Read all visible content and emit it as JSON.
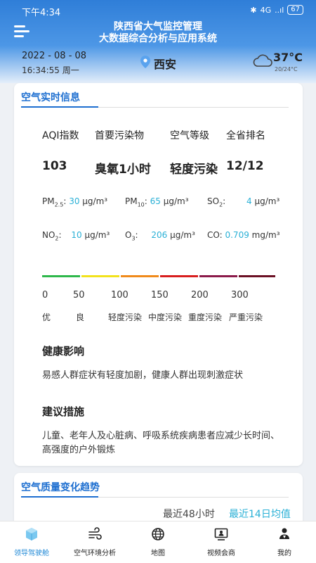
{
  "status": {
    "time": "下午4:34",
    "network": "4G",
    "signal": "..ıl",
    "battery": "67"
  },
  "app": {
    "title_line1": "陕西省大气监控管理",
    "title_line2": "大数据综合分析与应用系统"
  },
  "info": {
    "date": "2022 - 08 - 08",
    "time": "16:34:55 周一",
    "city": "西安",
    "temp": "37°C",
    "temp_range": "20/24°C"
  },
  "realtime": {
    "title": "空气实时信息",
    "headers": [
      "AQI指数",
      "首要污染物",
      "空气等级",
      "全省排名"
    ],
    "values": [
      "103",
      "臭氧1小时",
      "轻度污染",
      "12/12"
    ],
    "pollutants": [
      {
        "name": "PM",
        "sub": "2.5",
        "value": "30",
        "unit": "μg/m³"
      },
      {
        "name": "PM",
        "sub": "10",
        "value": "65",
        "unit": "μg/m³"
      },
      {
        "name": "SO",
        "sub": "2",
        "value": "4",
        "unit": "μg/m³"
      },
      {
        "name": "NO",
        "sub": "2",
        "value": "10",
        "unit": "μg/m³"
      },
      {
        "name": "O",
        "sub": "3",
        "value": "206",
        "unit": "μg/m³"
      },
      {
        "name": "CO",
        "sub": "",
        "value": "0.709",
        "unit": "mg/m³"
      }
    ],
    "scale": [
      "0",
      "50",
      "100",
      "150",
      "200",
      "300"
    ],
    "levels": [
      "优",
      "良",
      "轻度污染",
      "中度污染",
      "重度污染",
      "严重污染"
    ],
    "level_colors": [
      "#2eb84b",
      "#f2e21c",
      "#f08a1a",
      "#d81e1e",
      "#8b1a4a",
      "#6b1024"
    ],
    "health_title": "健康影响",
    "health_text": "易感人群症状有轻度加剧，健康人群出现刺激症状",
    "advice_title": "建议措施",
    "advice_text": "儿童、老年人及心脏病、呼吸系统疾病患者应减少长时间、高强度的户外锻炼"
  },
  "trend": {
    "title": "空气质量变化趋势",
    "option_a": "最近48小时",
    "option_b": "最近14日均值"
  },
  "nav": [
    "领导驾驶舱",
    "空气环境分析",
    "地图",
    "视频会商",
    "我的"
  ]
}
